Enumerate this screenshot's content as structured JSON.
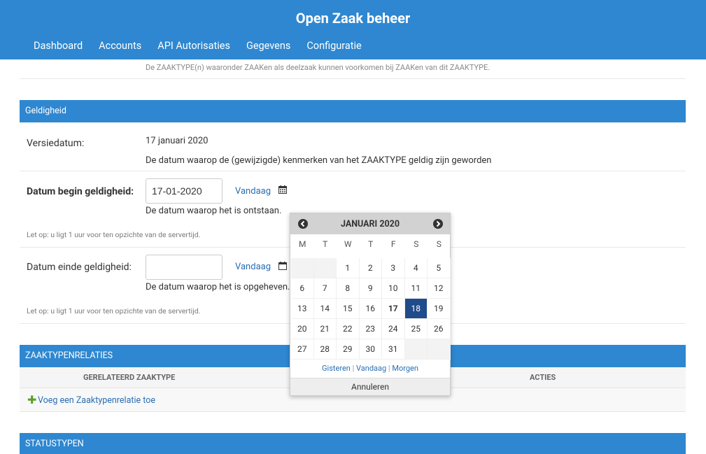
{
  "header": {
    "title": "Open Zaak beheer",
    "nav": [
      "Dashboard",
      "Accounts",
      "API Autorisaties",
      "Gegevens",
      "Configuratie"
    ]
  },
  "top_hint": "De ZAAKTYPE(n) waaronder ZAAKen als deelzaak kunnen voorkomen bij ZAAKen van dit ZAAKTYPE.",
  "geldigheid": {
    "section_title": "Geldigheid",
    "versiedatum_label": "Versiedatum:",
    "versiedatum_value": "17 januari 2020",
    "versiedatum_help": "De datum waarop de (gewijzigde) kenmerken van het ZAAKTYPE geldig zijn geworden",
    "begin_label": "Datum begin geldigheid:",
    "begin_value": "17-01-2020",
    "begin_help": "De datum waarop het is ontstaan.",
    "einde_label": "Datum einde geldigheid:",
    "einde_value": "",
    "einde_help": "De datum waarop het is opgeheven.",
    "today_link": "Vandaag",
    "server_note": "Let op: u ligt 1 uur voor ten opzichte van de servertijd."
  },
  "zaaktypenrelaties": {
    "section_title": "ZAAKTYPENRELATIES",
    "col_related": "GERELATEERD ZAAKTYPE",
    "col_actions": "ACTIES",
    "add_link": "Voeg een Zaaktypenrelatie toe"
  },
  "statustypen": {
    "section_title": "STATUSTYPEN"
  },
  "calendar": {
    "month_label": "JANUARI 2020",
    "weekdays": [
      "M",
      "T",
      "W",
      "T",
      "F",
      "S",
      "S"
    ],
    "weeks": [
      [
        "",
        "",
        "1",
        "2",
        "3",
        "4",
        "5"
      ],
      [
        "6",
        "7",
        "8",
        "9",
        "10",
        "11",
        "12"
      ],
      [
        "13",
        "14",
        "15",
        "16",
        "17",
        "18",
        "19"
      ],
      [
        "20",
        "21",
        "22",
        "23",
        "24",
        "25",
        "26"
      ],
      [
        "27",
        "28",
        "29",
        "30",
        "31",
        "",
        ""
      ]
    ],
    "today": "17",
    "selected": "18",
    "quick": {
      "yesterday": "Gisteren",
      "today": "Vandaag",
      "tomorrow": "Morgen"
    },
    "cancel": "Annuleren"
  },
  "colors": {
    "header_bg": "#2e87d0",
    "selected_day": "#1f4c8a",
    "link": "#2a6fb4",
    "add_icon": "#5aa02c"
  }
}
